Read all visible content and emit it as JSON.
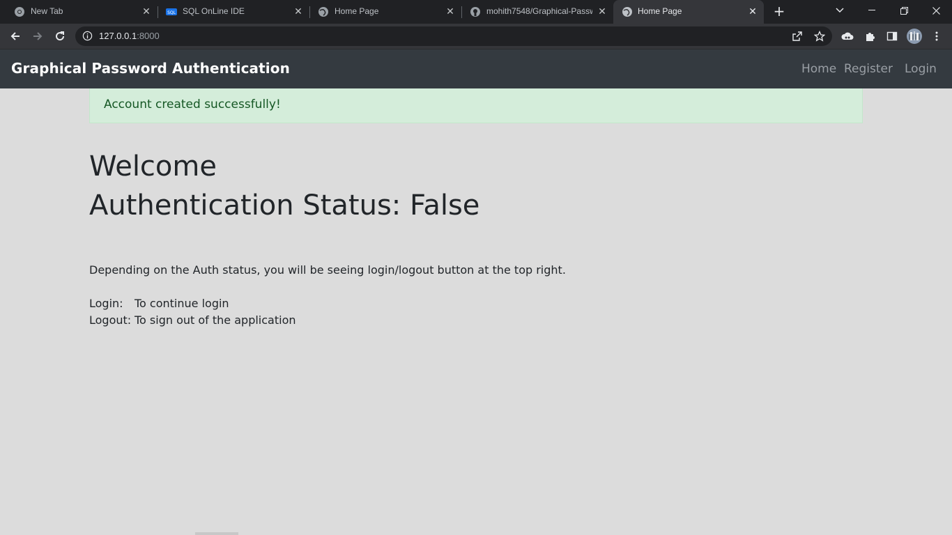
{
  "browser": {
    "tabs": [
      {
        "title": "New Tab",
        "icon": "chrome-icon",
        "active": false
      },
      {
        "title": "SQL OnLine IDE",
        "icon": "sql-icon",
        "active": false
      },
      {
        "title": "Home Page",
        "icon": "globe-icon",
        "active": false
      },
      {
        "title": "mohith7548/Graphical-Passw",
        "icon": "github-icon",
        "active": false
      },
      {
        "title": "Home Page",
        "icon": "globe-icon",
        "active": true
      }
    ],
    "address": {
      "host": "127.0.0.1",
      "port": ":8000"
    },
    "colors": {
      "tabstrip": "#202124",
      "toolbar": "#35363a",
      "omnibox": "#202124"
    }
  },
  "site": {
    "brand": "Graphical Password Authentication",
    "nav": {
      "home": "Home",
      "register": "Register",
      "login": "Login"
    },
    "alert": "Account created successfully!",
    "welcome": "Welcome",
    "status": "Authentication Status: False",
    "description": "Depending on the Auth status, you will be seeing login/logout button at the top right.",
    "login_label": "Login:",
    "login_text": "To continue login",
    "logout_label": "Logout:",
    "logout_text": "To sign out of the application",
    "colors": {
      "navbar": "#343a40",
      "alert_bg": "#d4edda",
      "alert_text": "#155724",
      "page_bg": "#dcdcdc"
    }
  }
}
